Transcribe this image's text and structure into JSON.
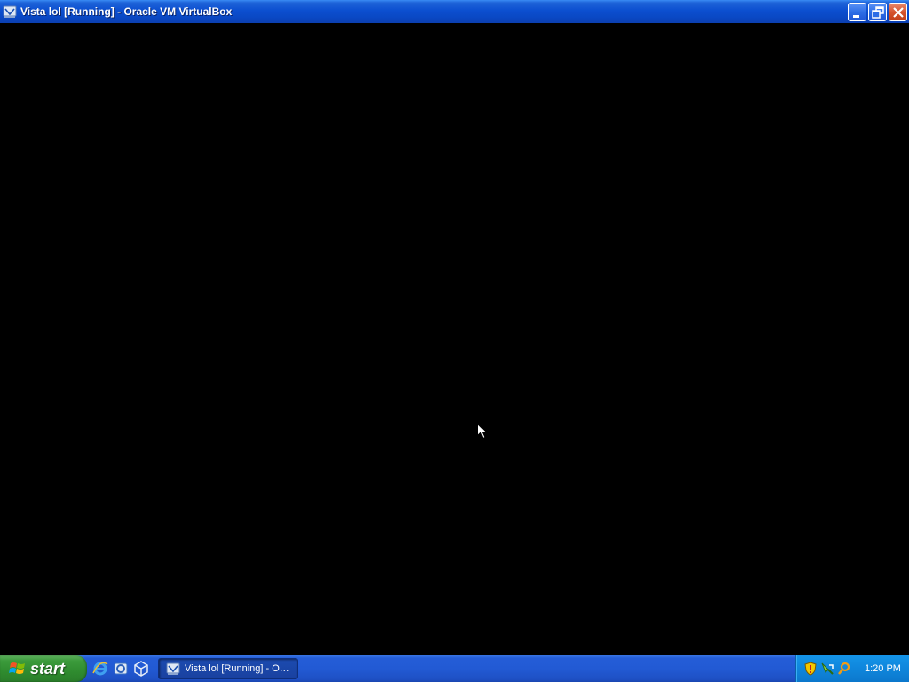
{
  "window": {
    "title": "Vista lol [Running] - Oracle VM VirtualBox",
    "app_icon": "virtualbox-icon",
    "buttons": {
      "minimize": "minimize-icon",
      "restore": "restore-icon",
      "close": "close-icon"
    }
  },
  "vm_screen": {
    "background": "#000000",
    "cursor": "mouse-pointer-icon"
  },
  "taskbar": {
    "start_label": "start",
    "quick_launch": [
      "internet-explorer-icon",
      "outlook-express-icon",
      "virtualbox-icon"
    ],
    "task_item_label": "Vista lol [Running] - O…",
    "tray_icons": [
      "security-shield-icon",
      "network-icon",
      "search-icon"
    ],
    "clock": "1:20 PM"
  },
  "colors": {
    "titlebar_blue": "#0a48c4",
    "close_red": "#d6542e",
    "start_green": "#3c9b3c",
    "tray_blue": "#0f86dc"
  }
}
